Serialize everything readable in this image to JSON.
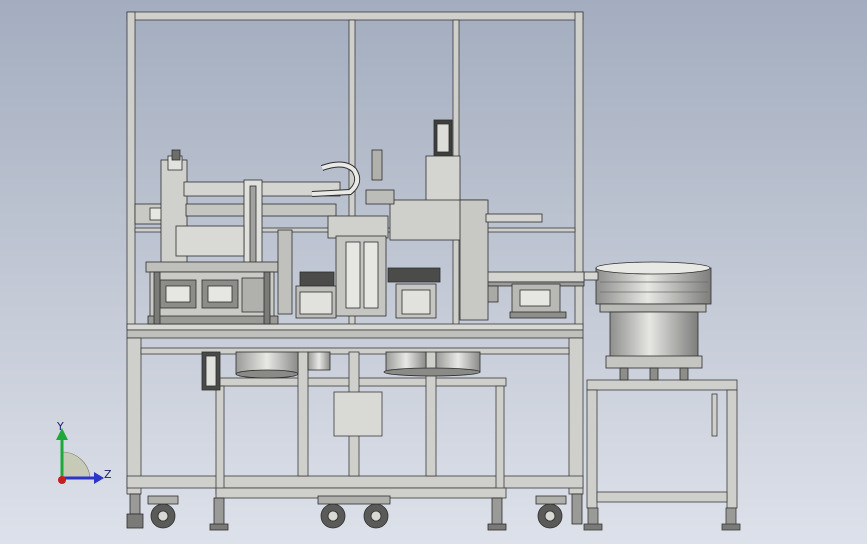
{
  "viewport": {
    "background_top": "#a3adbf",
    "background_bottom": "#dde1ea"
  },
  "model": {
    "frame_color": "#cfd0cc",
    "frame_edge": "#3a3a3a",
    "metal_light": "#e2e2df",
    "metal_mid": "#b9bab6",
    "metal_dark": "#6d6e6b"
  },
  "triad": {
    "y_label": "Y",
    "z_label": "Z",
    "y_color": "#1fa83a",
    "z_color": "#2b35c8",
    "origin_color": "#c81e1e",
    "icon": "coordinate-triad-icon"
  }
}
